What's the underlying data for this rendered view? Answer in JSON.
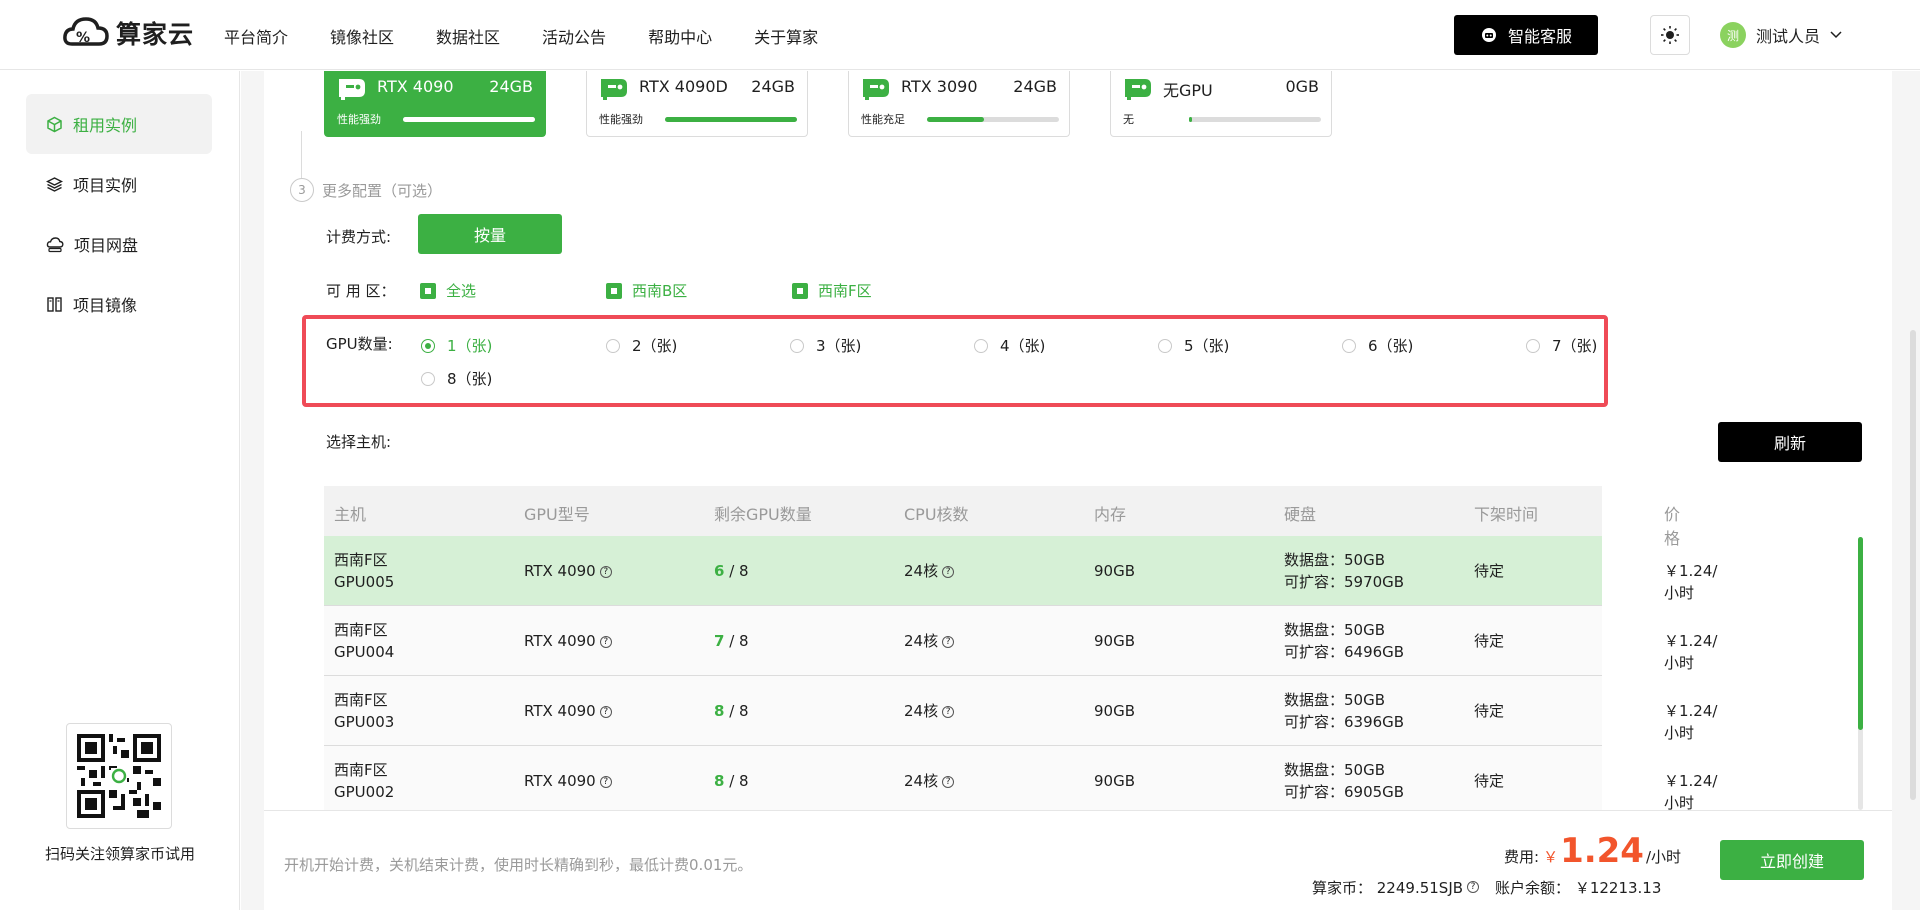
{
  "brand": {
    "name": "算家云",
    "accent": "#3cb043",
    "highlight": "#ef4b57"
  },
  "nav": [
    "平台简介",
    "镜像社区",
    "数据社区",
    "活动公告",
    "帮助中心",
    "关于算家"
  ],
  "header": {
    "customer_service": "智能客服",
    "user_name": "测试人员",
    "avatar_text": "测"
  },
  "sidebar": {
    "items": [
      {
        "label": "租用实例",
        "icon": "cube-icon",
        "active": true
      },
      {
        "label": "项目实例",
        "icon": "layers-icon"
      },
      {
        "label": "项目网盘",
        "icon": "cloud-drive-icon"
      },
      {
        "label": "项目镜像",
        "icon": "image-icon"
      }
    ],
    "qr_caption": "扫码关注领算家币试用"
  },
  "gpu_cards": [
    {
      "name": "RTX 4090",
      "mem": "24GB",
      "perf": "性能强劲",
      "level": 1.0,
      "selected": true
    },
    {
      "name": "RTX 4090D",
      "mem": "24GB",
      "perf": "性能强劲",
      "level": 1.0
    },
    {
      "name": "RTX 3090",
      "mem": "24GB",
      "perf": "性能充足",
      "level": 0.43
    },
    {
      "name": "无GPU",
      "mem": "0GB",
      "perf": "无",
      "level": 0.02
    }
  ],
  "more_config": {
    "step": "3",
    "title": "更多配置（可选）"
  },
  "billing": {
    "label": "计费方式:",
    "option": "按量"
  },
  "zones": {
    "label": "可 用 区：",
    "options": [
      "全选",
      "西南B区",
      "西南F区"
    ]
  },
  "gpu_count": {
    "label": "GPU数量:",
    "options": [
      "1（张)",
      "2（张)",
      "3（张)",
      "4（张)",
      "5（张)",
      "6（张)",
      "7（张)",
      "8（张)"
    ],
    "selected_index": 0
  },
  "host": {
    "label": "选择主机:",
    "refresh": "刷新"
  },
  "table": {
    "columns": [
      "主机",
      "GPU型号",
      "剩余GPU数量",
      "CPU核数",
      "内存",
      "硬盘",
      "下架时间",
      "价格"
    ],
    "rows": [
      {
        "zone": "西南F区",
        "host": "GPU005",
        "gpu": "RTX 4090",
        "avail": "6",
        "total": "/ 8",
        "cpu": "24核",
        "mem": "90GB",
        "disk": "数据盘：50GB",
        "expand": "可扩容：5970GB",
        "offline": "待定",
        "price": "￥1.24/小时",
        "selected": true
      },
      {
        "zone": "西南F区",
        "host": "GPU004",
        "gpu": "RTX 4090",
        "avail": "7",
        "total": "/ 8",
        "cpu": "24核",
        "mem": "90GB",
        "disk": "数据盘：50GB",
        "expand": "可扩容：6496GB",
        "offline": "待定",
        "price": "￥1.24/小时"
      },
      {
        "zone": "西南F区",
        "host": "GPU003",
        "gpu": "RTX 4090",
        "avail": "8",
        "total": "/ 8",
        "cpu": "24核",
        "mem": "90GB",
        "disk": "数据盘：50GB",
        "expand": "可扩容：6396GB",
        "offline": "待定",
        "price": "￥1.24/小时"
      },
      {
        "zone": "西南F区",
        "host": "GPU002",
        "gpu": "RTX 4090",
        "avail": "8",
        "total": "/ 8",
        "cpu": "24核",
        "mem": "90GB",
        "disk": "数据盘：50GB",
        "expand": "可扩容：6905GB",
        "offline": "待定",
        "price": "￥1.24/小时"
      }
    ]
  },
  "footer": {
    "note": "开机开始计费，关机结束计费，使用时长精确到秒，最低计费0.01元。",
    "fee_label": "费用:",
    "currency": "￥",
    "amount": "1.24",
    "unit": "/小时",
    "coins": "算家币：  2249.51SJB",
    "balance": "账户余额：  ￥12213.13",
    "create": "立即创建"
  }
}
